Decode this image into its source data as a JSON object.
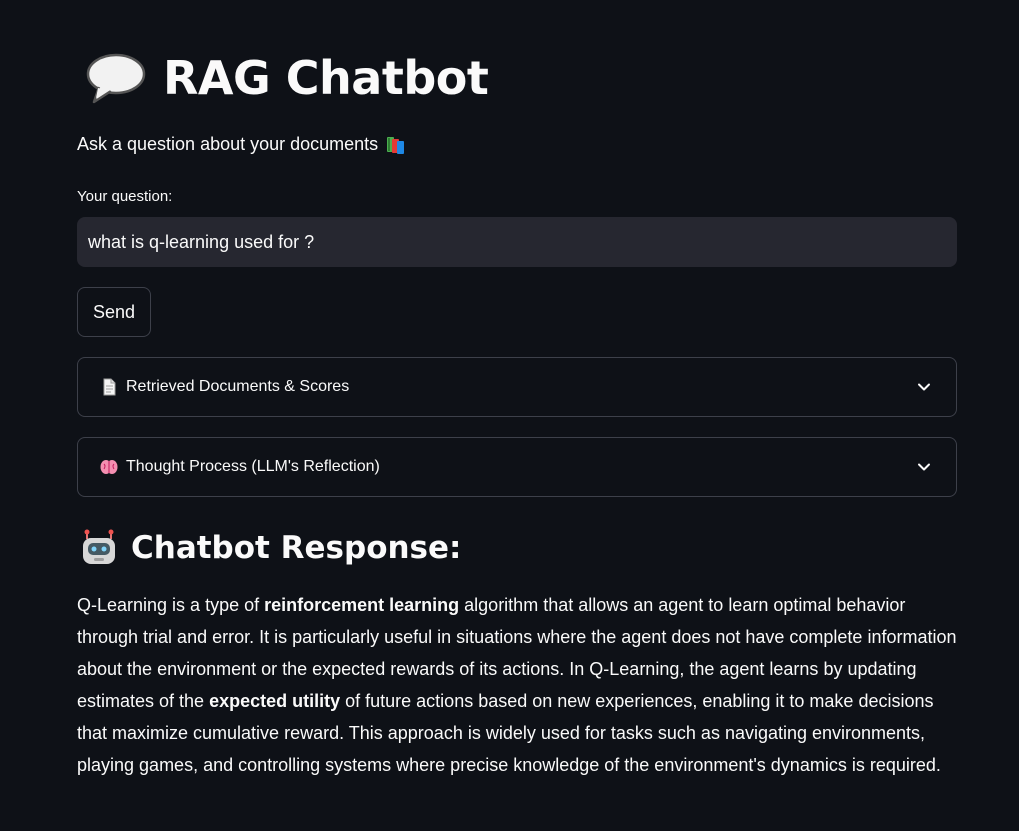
{
  "header": {
    "title": "RAG Chatbot",
    "title_icon": "speech-balloon-icon",
    "subtitle": "Ask a question about your documents",
    "subtitle_icon": "books-icon"
  },
  "question": {
    "label": "Your question:",
    "value": "what is q-learning used for ?"
  },
  "actions": {
    "send_label": "Send"
  },
  "expanders": [
    {
      "icon": "page-icon",
      "label": "Retrieved Documents & Scores",
      "expanded": false
    },
    {
      "icon": "brain-icon",
      "label": "Thought Process (LLM's Reflection)",
      "expanded": false
    }
  ],
  "response": {
    "icon": "robot-icon",
    "heading": "Chatbot Response:",
    "text_1": "Q-Learning is a type of ",
    "bold_1": "reinforcement learning",
    "text_2": " algorithm that allows an agent to learn optimal behavior through trial and error. It is particularly useful in situations where the agent does not have complete information about the environment or the expected rewards of its actions. In Q-Learning, the agent learns by updating estimates of the ",
    "bold_2": "expected utility",
    "text_3": " of future actions based on new experiences, enabling it to make decisions that maximize cumulative reward. This approach is widely used for tasks such as navigating environments, playing games, and controlling systems where precise knowledge of the environment's dynamics is required."
  },
  "colors": {
    "background": "#0e1117",
    "input_background": "#262730",
    "border": "#3d404a",
    "text": "#fafafa"
  }
}
